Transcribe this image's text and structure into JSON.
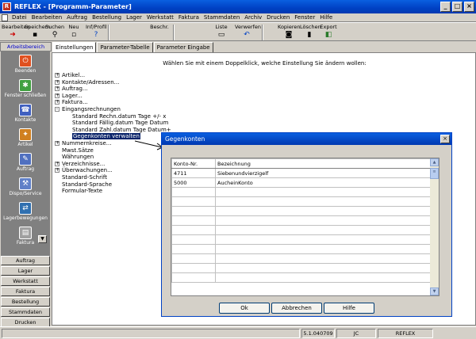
{
  "window": {
    "title": "REFLEX - [Programm-Parameter]"
  },
  "menu": [
    "Datei",
    "Bearbeiten",
    "Auftrag",
    "Bestellung",
    "Lager",
    "Werkstatt",
    "Faktura",
    "Stammdaten",
    "Archiv",
    "Drucken",
    "Fenster",
    "Hilfe"
  ],
  "toolbar": {
    "buttons": [
      "Bearbeiten",
      "Speichern",
      "Suchen",
      "Neu",
      "Inf/Profil",
      "Beschr.",
      "Liste",
      "Verwerfen",
      "Kopieren",
      "Löschen",
      "Export"
    ]
  },
  "left": {
    "header": "Arbeitsbereich",
    "icons": [
      "Beenden",
      "Fenster schließen",
      "Kontakte",
      "Artikel",
      "Auftrag",
      "Dispo/Service",
      "Lagerbewegungen",
      "Faktura"
    ],
    "nav": [
      "Auftrag",
      "Lager",
      "Werkstatt",
      "Faktura",
      "Bestellung",
      "Stammdaten",
      "Drucken"
    ]
  },
  "tabs": [
    "Einstellungen",
    "Parameter-Tabelle",
    "Parameter Eingabe"
  ],
  "instruction": "Wählen Sie mit einem Doppelklick, welche Einstellung Sie ändern wollen:",
  "tree": [
    {
      "label": "Artikel...",
      "exp": "+"
    },
    {
      "label": "Kontakte/Adressen...",
      "exp": "+"
    },
    {
      "label": "Auftrag...",
      "exp": "+"
    },
    {
      "label": "Lager...",
      "exp": "+"
    },
    {
      "label": "Faktura...",
      "exp": "+"
    },
    {
      "label": "Eingangsrechnungen",
      "exp": "-"
    },
    {
      "label": "Standard Rechn.datum Tage +/- x",
      "child": true
    },
    {
      "label": "Standard Fällig.datum Tage Datum",
      "child": true
    },
    {
      "label": "Standard Zahl.datum Tage Datum+",
      "child": true
    },
    {
      "label": "Gegenkonten verwalten",
      "child": true,
      "selected": true
    },
    {
      "label": "Nummernkreise...",
      "exp": "+"
    },
    {
      "label": "Mwst.Sätze"
    },
    {
      "label": "Währungen"
    },
    {
      "label": "Verzeichnisse...",
      "exp": "+"
    },
    {
      "label": "Überwachungen...",
      "exp": "+"
    },
    {
      "label": "Standard-Schrift"
    },
    {
      "label": "Standard-Sprache"
    },
    {
      "label": "Formular-Texte"
    }
  ],
  "dialog": {
    "title": "Gegenkonten",
    "close": "×",
    "columns": [
      "Konto-Nr.",
      "Bezeichnung"
    ],
    "rows": [
      [
        "4711",
        "Siebenundvierzigelf"
      ],
      [
        "5000",
        "AucheinKonto"
      ]
    ],
    "buttons": [
      "Ok",
      "Abbrechen",
      "Hilfe"
    ]
  },
  "status": {
    "version": "5.1.040709",
    "user": "JC",
    "app": "REFLEX"
  }
}
